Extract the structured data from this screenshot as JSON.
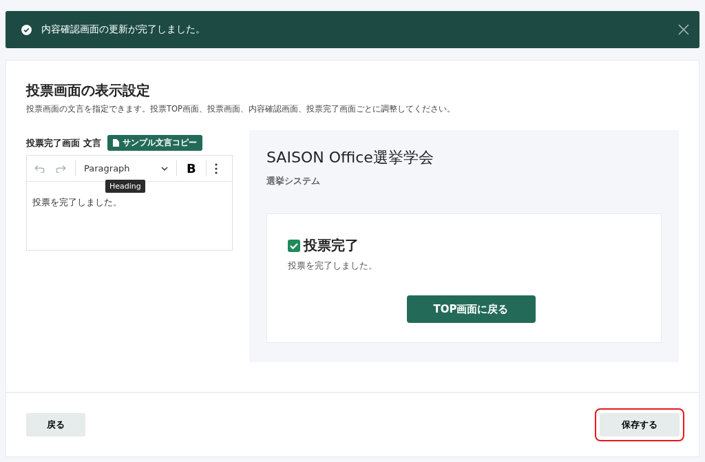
{
  "toast": {
    "message": "内容確認画面の更新が完了しました。"
  },
  "page": {
    "title": "投票画面の表示設定",
    "description": "投票画面の文言を指定できます。投票TOP画面、投票画面、内容確認画面、投票完了画面ごとに調整してください。"
  },
  "editor": {
    "label": "投票完了画面 文言",
    "sample_button": "サンプル文言コピー",
    "format": "Paragraph",
    "bold": "B",
    "tooltip": "Heading",
    "content": "投票を完了しました。"
  },
  "preview": {
    "site_title": "SAISON Office選挙学会",
    "site_subtitle": "選挙システム",
    "heading": "投票完了",
    "message": "投票を完了しました。",
    "button": "TOP画面に戻る"
  },
  "footer": {
    "buttons": [
      {
        "label": "戻る",
        "highlighted": false
      },
      {
        "label": "保存する",
        "highlighted": true
      }
    ]
  }
}
